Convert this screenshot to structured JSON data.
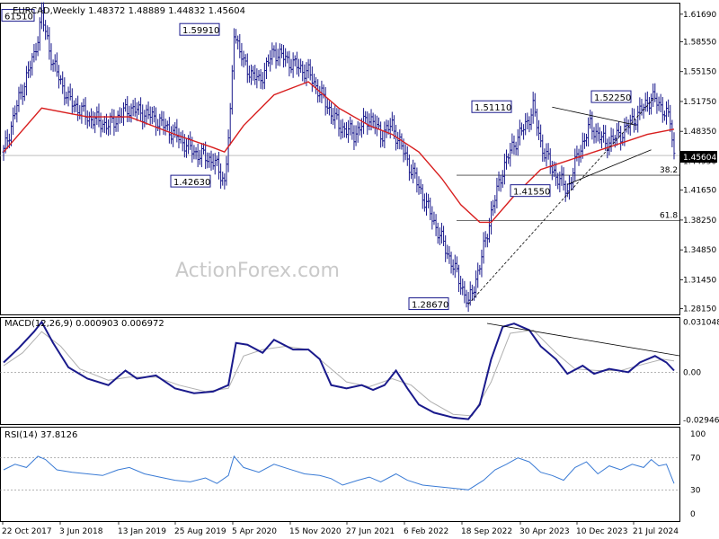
{
  "colors": {
    "bar": "#1a1a8c",
    "ma": "#d81e1e",
    "macd": "#1a1a8c",
    "signal": "#b0b0b0",
    "rsi": "#3a7bd5",
    "frame": "#000000",
    "hline": "#444444",
    "current_box": "#000000"
  },
  "header": {
    "price": "EURCAD,Weekly  1.48372 1.48889 1.44832 1.45604",
    "macd": "MACD(12,26,9) 0.000903 0.006972",
    "rsi": "RSI(14) 37.8126"
  },
  "watermark": "ActionForex.com",
  "chart_data": [
    {
      "type": "bar",
      "panel": "price",
      "symbol": "EURCAD",
      "period": "Weekly",
      "ohlc_last": {
        "open": 1.48372,
        "high": 1.48889,
        "low": 1.44832,
        "close": 1.45604
      },
      "ylim": [
        1.275,
        1.63
      ],
      "yticks": [
        "1.61690",
        "1.58550",
        "1.55150",
        "1.51750",
        "1.48350",
        "1.44950",
        "1.41650",
        "1.38250",
        "1.34850",
        "1.31450",
        "1.28150"
      ],
      "ytick_values": [
        1.6169,
        1.5855,
        1.5515,
        1.5175,
        1.4835,
        1.4495,
        1.4165,
        1.3825,
        1.3485,
        1.3145,
        1.2815
      ],
      "current_price_label": "1.45604",
      "xticks": [
        "22 Oct 2017",
        "3 Jun 2018",
        "13 Jan 2019",
        "25 Aug 2019",
        "5 Apr 2020",
        "15 Nov 2020",
        "27 Jun 2021",
        "6 Feb 2022",
        "18 Sep 2022",
        "30 Apr 2023",
        "10 Dec 2023",
        "21 Jul 2024"
      ],
      "close_path": [
        [
          0,
          1.46
        ],
        [
          8,
          1.52
        ],
        [
          16,
          1.57
        ],
        [
          20,
          1.6151
        ],
        [
          26,
          1.56
        ],
        [
          34,
          1.52
        ],
        [
          44,
          1.5
        ],
        [
          55,
          1.49
        ],
        [
          66,
          1.51
        ],
        [
          78,
          1.5
        ],
        [
          90,
          1.48
        ],
        [
          100,
          1.46
        ],
        [
          110,
          1.45
        ],
        [
          116,
          1.4263
        ],
        [
          119,
          1.5
        ],
        [
          121,
          1.5991
        ],
        [
          126,
          1.56
        ],
        [
          134,
          1.54
        ],
        [
          142,
          1.575
        ],
        [
          152,
          1.56
        ],
        [
          160,
          1.55
        ],
        [
          168,
          1.52
        ],
        [
          176,
          1.49
        ],
        [
          184,
          1.48
        ],
        [
          192,
          1.5
        ],
        [
          198,
          1.48
        ],
        [
          204,
          1.49
        ],
        [
          210,
          1.46
        ],
        [
          218,
          1.42
        ],
        [
          226,
          1.38
        ],
        [
          234,
          1.34
        ],
        [
          240,
          1.31
        ],
        [
          244,
          1.2867
        ],
        [
          250,
          1.33
        ],
        [
          256,
          1.39
        ],
        [
          262,
          1.44
        ],
        [
          268,
          1.47
        ],
        [
          274,
          1.49
        ],
        [
          278,
          1.5111
        ],
        [
          282,
          1.47
        ],
        [
          288,
          1.44
        ],
        [
          296,
          1.4155
        ],
        [
          302,
          1.46
        ],
        [
          308,
          1.49
        ],
        [
          316,
          1.47
        ],
        [
          324,
          1.48
        ],
        [
          332,
          1.5
        ],
        [
          340,
          1.5225
        ],
        [
          346,
          1.51
        ],
        [
          350,
          1.495
        ],
        [
          352,
          1.456
        ]
      ],
      "ma_path": [
        [
          0,
          1.46
        ],
        [
          20,
          1.51
        ],
        [
          44,
          1.5
        ],
        [
          66,
          1.5
        ],
        [
          90,
          1.48
        ],
        [
          110,
          1.465
        ],
        [
          116,
          1.46
        ],
        [
          126,
          1.49
        ],
        [
          142,
          1.525
        ],
        [
          160,
          1.54
        ],
        [
          176,
          1.51
        ],
        [
          192,
          1.49
        ],
        [
          204,
          1.48
        ],
        [
          218,
          1.46
        ],
        [
          230,
          1.43
        ],
        [
          240,
          1.4
        ],
        [
          250,
          1.38
        ],
        [
          256,
          1.38
        ],
        [
          268,
          1.41
        ],
        [
          282,
          1.44
        ],
        [
          296,
          1.45
        ],
        [
          310,
          1.46
        ],
        [
          324,
          1.47
        ],
        [
          338,
          1.48
        ],
        [
          352,
          1.486
        ]
      ],
      "levels": [
        {
          "label": "38.2",
          "value": 1.4335
        },
        {
          "label": "61.8",
          "value": 1.382
        }
      ],
      "annotations": [
        "61510",
        "1.59910",
        "1.42630",
        "1.28670",
        "1.51110",
        "1.41550",
        "1.52250"
      ],
      "trendlines": [
        "uptrend 1.28670 -> 1.52250",
        "triangle upper from 1.51110",
        "triangle lower from 1.41550"
      ]
    },
    {
      "type": "line",
      "panel": "macd",
      "name": "MACD(12,26,9)",
      "macd": 0.000903,
      "signal": 0.006972,
      "yticks": [
        "0.031048",
        "0.00",
        "-0.029469"
      ],
      "ytick_values": [
        0.031048,
        0.0,
        -0.029469
      ],
      "ylim": [
        -0.032,
        0.034
      ],
      "macd_path": [
        [
          0,
          0.006
        ],
        [
          8,
          0.015
        ],
        [
          16,
          0.025
        ],
        [
          20,
          0.031
        ],
        [
          26,
          0.018
        ],
        [
          34,
          0.003
        ],
        [
          44,
          -0.004
        ],
        [
          55,
          -0.008
        ],
        [
          64,
          0.001
        ],
        [
          70,
          -0.004
        ],
        [
          80,
          -0.002
        ],
        [
          90,
          -0.01
        ],
        [
          100,
          -0.013
        ],
        [
          110,
          -0.012
        ],
        [
          118,
          -0.008
        ],
        [
          122,
          0.018
        ],
        [
          128,
          0.017
        ],
        [
          136,
          0.012
        ],
        [
          142,
          0.02
        ],
        [
          152,
          0.014
        ],
        [
          160,
          0.014
        ],
        [
          166,
          0.008
        ],
        [
          172,
          -0.008
        ],
        [
          180,
          -0.01
        ],
        [
          188,
          -0.008
        ],
        [
          194,
          -0.011
        ],
        [
          200,
          -0.008
        ],
        [
          206,
          0.001
        ],
        [
          212,
          -0.01
        ],
        [
          218,
          -0.02
        ],
        [
          226,
          -0.025
        ],
        [
          236,
          -0.028
        ],
        [
          244,
          -0.029
        ],
        [
          250,
          -0.02
        ],
        [
          256,
          0.008
        ],
        [
          262,
          0.028
        ],
        [
          268,
          0.03
        ],
        [
          276,
          0.026
        ],
        [
          282,
          0.016
        ],
        [
          290,
          0.008
        ],
        [
          296,
          -0.001
        ],
        [
          304,
          0.004
        ],
        [
          310,
          -0.001
        ],
        [
          318,
          0.002
        ],
        [
          328,
          0.0
        ],
        [
          334,
          0.006
        ],
        [
          342,
          0.01
        ],
        [
          348,
          0.006
        ],
        [
          352,
          0.001
        ]
      ],
      "signal_path": [
        [
          0,
          0.004
        ],
        [
          10,
          0.012
        ],
        [
          20,
          0.025
        ],
        [
          30,
          0.016
        ],
        [
          40,
          0.002
        ],
        [
          55,
          -0.005
        ],
        [
          66,
          -0.003
        ],
        [
          80,
          -0.003
        ],
        [
          92,
          -0.008
        ],
        [
          106,
          -0.012
        ],
        [
          118,
          -0.01
        ],
        [
          126,
          0.01
        ],
        [
          136,
          0.014
        ],
        [
          148,
          0.016
        ],
        [
          160,
          0.014
        ],
        [
          170,
          0.004
        ],
        [
          180,
          -0.006
        ],
        [
          192,
          -0.009
        ],
        [
          204,
          -0.004
        ],
        [
          214,
          -0.008
        ],
        [
          224,
          -0.018
        ],
        [
          236,
          -0.026
        ],
        [
          246,
          -0.027
        ],
        [
          256,
          -0.006
        ],
        [
          266,
          0.024
        ],
        [
          278,
          0.026
        ],
        [
          290,
          0.012
        ],
        [
          300,
          0.002
        ],
        [
          312,
          0.001
        ],
        [
          324,
          0.001
        ],
        [
          336,
          0.005
        ],
        [
          346,
          0.008
        ],
        [
          352,
          0.007
        ]
      ]
    },
    {
      "type": "line",
      "panel": "rsi",
      "name": "RSI(14)",
      "value": 37.8126,
      "yticks": [
        "100",
        "70",
        "30",
        "0"
      ],
      "ytick_values": [
        100,
        70,
        30,
        0
      ],
      "ylim": [
        0,
        100
      ],
      "rsi_path": [
        [
          0,
          55
        ],
        [
          6,
          62
        ],
        [
          12,
          58
        ],
        [
          18,
          72
        ],
        [
          22,
          68
        ],
        [
          28,
          55
        ],
        [
          36,
          52
        ],
        [
          44,
          50
        ],
        [
          52,
          48
        ],
        [
          60,
          55
        ],
        [
          66,
          58
        ],
        [
          74,
          50
        ],
        [
          82,
          46
        ],
        [
          90,
          42
        ],
        [
          98,
          40
        ],
        [
          106,
          45
        ],
        [
          112,
          38
        ],
        [
          118,
          48
        ],
        [
          121,
          72
        ],
        [
          126,
          58
        ],
        [
          134,
          52
        ],
        [
          142,
          62
        ],
        [
          150,
          56
        ],
        [
          158,
          50
        ],
        [
          166,
          48
        ],
        [
          172,
          44
        ],
        [
          178,
          36
        ],
        [
          186,
          42
        ],
        [
          192,
          46
        ],
        [
          198,
          40
        ],
        [
          206,
          50
        ],
        [
          212,
          42
        ],
        [
          220,
          36
        ],
        [
          228,
          34
        ],
        [
          236,
          32
        ],
        [
          244,
          30
        ],
        [
          252,
          42
        ],
        [
          258,
          55
        ],
        [
          264,
          62
        ],
        [
          270,
          70
        ],
        [
          276,
          65
        ],
        [
          282,
          52
        ],
        [
          288,
          48
        ],
        [
          294,
          42
        ],
        [
          300,
          58
        ],
        [
          306,
          65
        ],
        [
          312,
          50
        ],
        [
          318,
          60
        ],
        [
          324,
          55
        ],
        [
          330,
          62
        ],
        [
          336,
          58
        ],
        [
          340,
          68
        ],
        [
          344,
          60
        ],
        [
          348,
          62
        ],
        [
          352,
          38
        ]
      ]
    }
  ]
}
